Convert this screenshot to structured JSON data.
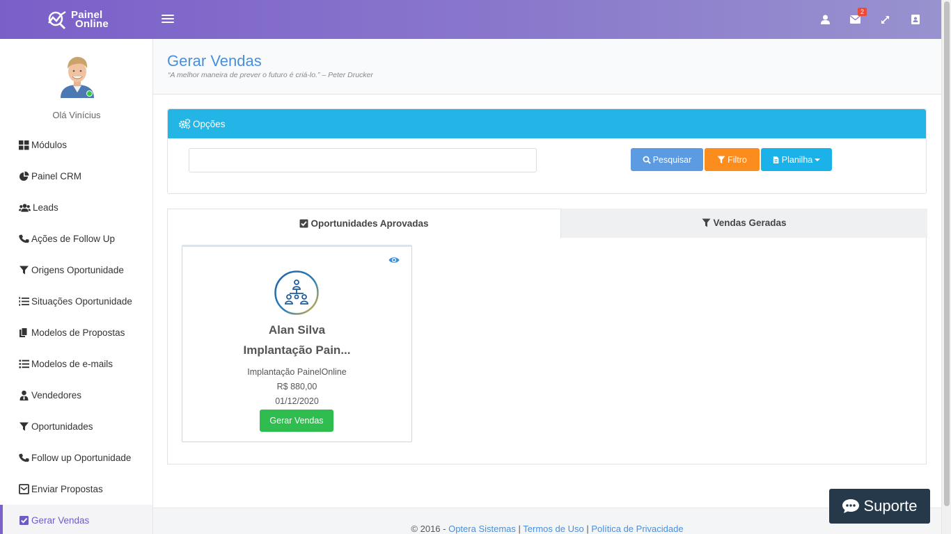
{
  "brand": {
    "line1": "Painel",
    "line2": "Online"
  },
  "topbar": {
    "icons": [
      "user-icon",
      "envelope-icon",
      "expand-icon",
      "address-book-icon"
    ],
    "mail_badge": "2"
  },
  "sidebar": {
    "greeting": "Olá Vinícius",
    "items": [
      {
        "label": "Módulos",
        "icon": "th-large-icon"
      },
      {
        "label": "Painel CRM",
        "icon": "pie-chart-icon"
      },
      {
        "label": "Leads",
        "icon": "users-icon"
      },
      {
        "label": "Ações de Follow Up",
        "icon": "phone-icon"
      },
      {
        "label": "Origens Oportunidade",
        "icon": "filter-icon"
      },
      {
        "label": "Situações Oportunidade",
        "icon": "list-ol-icon"
      },
      {
        "label": "Modelos de Propostas",
        "icon": "files-icon"
      },
      {
        "label": "Modelos de e-mails",
        "icon": "list-icon"
      },
      {
        "label": "Vendedores",
        "icon": "user-tie-icon"
      },
      {
        "label": "Oportunidades",
        "icon": "filter-icon"
      },
      {
        "label": "Follow up Oportunidade",
        "icon": "phone-icon"
      },
      {
        "label": "Enviar Propostas",
        "icon": "envelope-square-icon"
      },
      {
        "label": "Gerar Vendas",
        "icon": "check-square-icon",
        "active": true
      }
    ]
  },
  "header": {
    "title": "Gerar Vendas",
    "quote": "“A melhor maneira de prever o futuro é criá-lo.” – Peter Drucker"
  },
  "options": {
    "title": "Opções",
    "search_value": "",
    "search_label": "Pesquisar",
    "filter_label": "Filtro",
    "sheet_label": "Planilha"
  },
  "tabs": [
    {
      "label": "Oportunidades Aprovadas",
      "active": true
    },
    {
      "label": "Vendas Geradas",
      "active": false
    }
  ],
  "card": {
    "name": "Alan Silva",
    "title": "Implantação Pain...",
    "description": "Implantação PainelOnline",
    "value": "R$ 880,00",
    "date": "01/12/2020",
    "button": "Gerar Vendas"
  },
  "footer": {
    "copyright": "© 2016 - ",
    "link1": "Optera Sistemas",
    "sep1": " | ",
    "link2": "Termos de Uso",
    "sep2": " | ",
    "link3": "Política de Privacidade"
  },
  "support": {
    "label": "Suporte"
  },
  "colors": {
    "topbar_start": "#7b5fc9",
    "topbar_end": "#9892cf",
    "panel_heading": "#22b5e6",
    "btn_search": "#5c9ae2",
    "btn_filter": "#fb8c1e",
    "btn_sheet": "#1ab2e8",
    "btn_success": "#2ebd4e",
    "title_blue": "#4a8fd9",
    "support_bg": "#26394b"
  }
}
